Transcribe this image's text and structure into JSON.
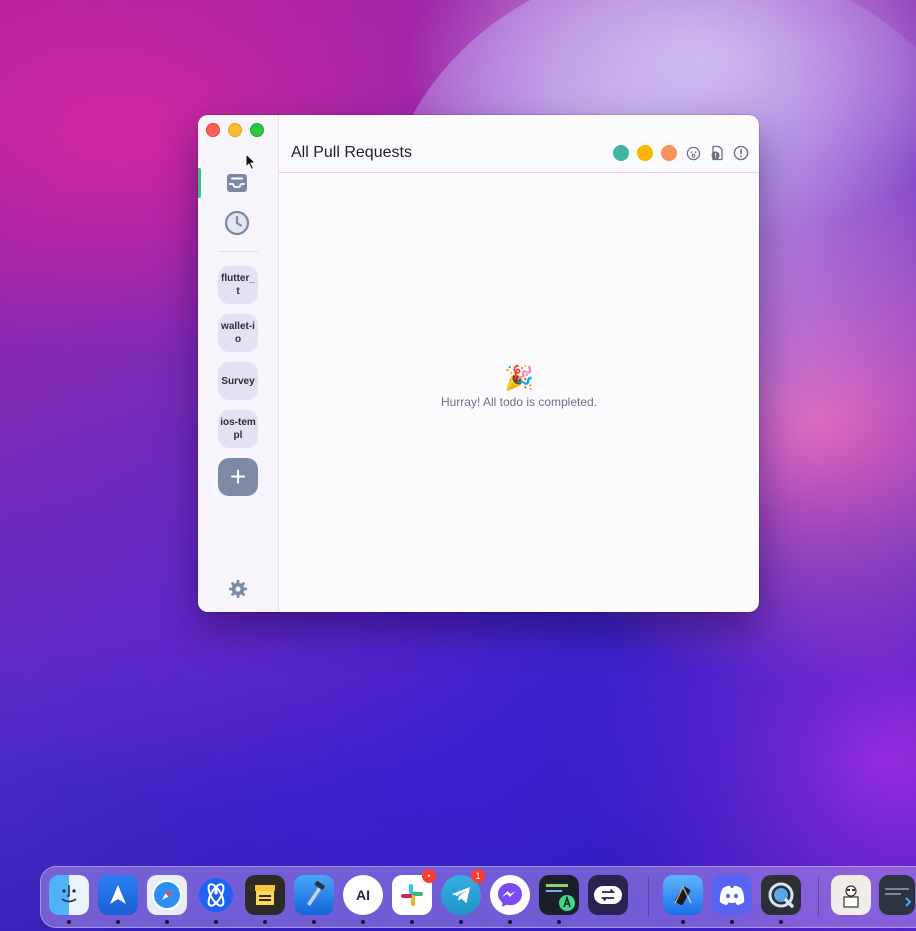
{
  "window": {
    "title": "All Pull Requests",
    "sidebar": {
      "repos": [
        {
          "label": "flutter_t"
        },
        {
          "label": "wallet-io"
        },
        {
          "label": "Survey"
        },
        {
          "label": "ios-templ"
        }
      ],
      "add_label": "+"
    },
    "header": {
      "status_colors": [
        "#3fb6a3",
        "#fbb400",
        "#f8935b"
      ]
    },
    "empty_state": {
      "emoji": "🎉",
      "message": "Hurray! All todo is completed."
    }
  },
  "dock": {
    "apps": [
      {
        "name": "Finder"
      },
      {
        "name": "Spark"
      },
      {
        "name": "Safari"
      },
      {
        "name": "Xcode Cloud"
      },
      {
        "name": "Archive"
      },
      {
        "name": "Xcode"
      },
      {
        "name": "Adobe Illustrator",
        "glyph": "AI"
      },
      {
        "name": "Slack",
        "badge": "•"
      },
      {
        "name": "Telegram",
        "badge": "1"
      },
      {
        "name": "Messenger"
      },
      {
        "name": "Android Studio"
      },
      {
        "name": "Switch"
      },
      {
        "name": "Simulator"
      },
      {
        "name": "Discord"
      },
      {
        "name": "QuickTime"
      },
      {
        "name": "Preview"
      },
      {
        "name": "Screenshot"
      }
    ]
  }
}
